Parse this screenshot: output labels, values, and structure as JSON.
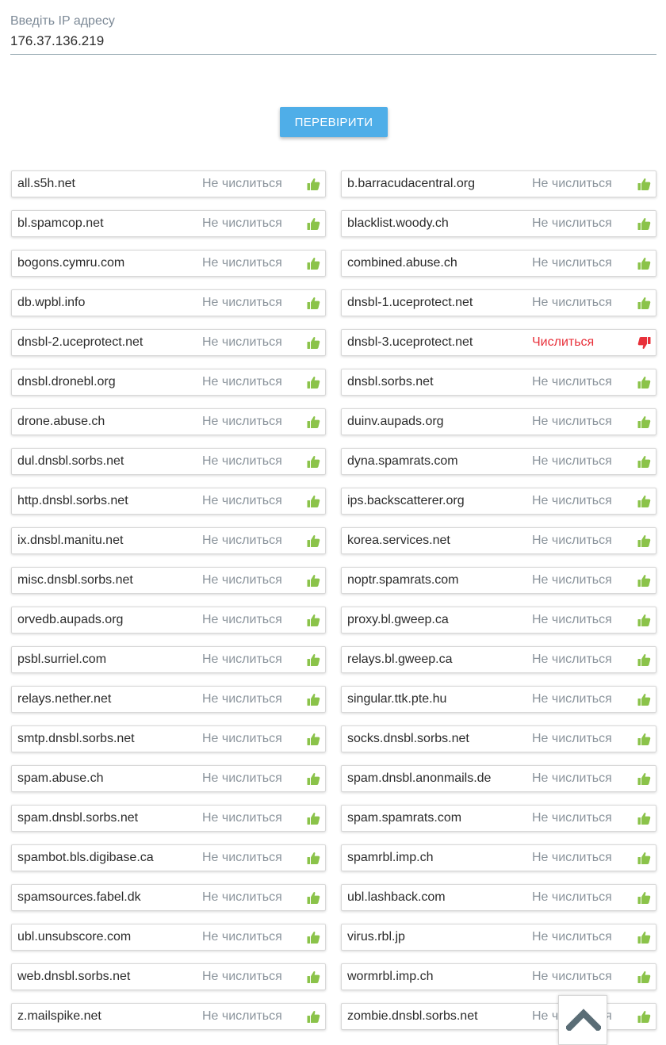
{
  "ip_form": {
    "label": "Введіть IP адресу",
    "value": "176.37.136.219",
    "submit_label": "ПЕРЕВІРИТИ"
  },
  "status_labels": {
    "not_listed": "Не числиться",
    "listed": "Числиться"
  },
  "colors": {
    "accent": "#4faee8",
    "ok": "#8bc34a",
    "listed": "#e8303a",
    "status_text": "#8b949c"
  },
  "icons": {
    "not_listed": "thumbs-up-icon",
    "listed": "thumbs-down-icon",
    "scroll_top": "chevron-up-icon"
  },
  "results": [
    {
      "host": "all.s5h.net",
      "listed": false
    },
    {
      "host": "b.barracudacentral.org",
      "listed": false
    },
    {
      "host": "bl.spamcop.net",
      "listed": false
    },
    {
      "host": "blacklist.woody.ch",
      "listed": false
    },
    {
      "host": "bogons.cymru.com",
      "listed": false
    },
    {
      "host": "combined.abuse.ch",
      "listed": false
    },
    {
      "host": "db.wpbl.info",
      "listed": false
    },
    {
      "host": "dnsbl-1.uceprotect.net",
      "listed": false
    },
    {
      "host": "dnsbl-2.uceprotect.net",
      "listed": false
    },
    {
      "host": "dnsbl-3.uceprotect.net",
      "listed": true
    },
    {
      "host": "dnsbl.dronebl.org",
      "listed": false
    },
    {
      "host": "dnsbl.sorbs.net",
      "listed": false
    },
    {
      "host": "drone.abuse.ch",
      "listed": false
    },
    {
      "host": "duinv.aupads.org",
      "listed": false
    },
    {
      "host": "dul.dnsbl.sorbs.net",
      "listed": false
    },
    {
      "host": "dyna.spamrats.com",
      "listed": false
    },
    {
      "host": "http.dnsbl.sorbs.net",
      "listed": false
    },
    {
      "host": "ips.backscatterer.org",
      "listed": false
    },
    {
      "host": "ix.dnsbl.manitu.net",
      "listed": false
    },
    {
      "host": "korea.services.net",
      "listed": false
    },
    {
      "host": "misc.dnsbl.sorbs.net",
      "listed": false
    },
    {
      "host": "noptr.spamrats.com",
      "listed": false
    },
    {
      "host": "orvedb.aupads.org",
      "listed": false
    },
    {
      "host": "proxy.bl.gweep.ca",
      "listed": false
    },
    {
      "host": "psbl.surriel.com",
      "listed": false
    },
    {
      "host": "relays.bl.gweep.ca",
      "listed": false
    },
    {
      "host": "relays.nether.net",
      "listed": false
    },
    {
      "host": "singular.ttk.pte.hu",
      "listed": false
    },
    {
      "host": "smtp.dnsbl.sorbs.net",
      "listed": false
    },
    {
      "host": "socks.dnsbl.sorbs.net",
      "listed": false
    },
    {
      "host": "spam.abuse.ch",
      "listed": false
    },
    {
      "host": "spam.dnsbl.anonmails.de",
      "listed": false
    },
    {
      "host": "spam.dnsbl.sorbs.net",
      "listed": false
    },
    {
      "host": "spam.spamrats.com",
      "listed": false
    },
    {
      "host": "spambot.bls.digibase.ca",
      "listed": false
    },
    {
      "host": "spamrbl.imp.ch",
      "listed": false
    },
    {
      "host": "spamsources.fabel.dk",
      "listed": false
    },
    {
      "host": "ubl.lashback.com",
      "listed": false
    },
    {
      "host": "ubl.unsubscore.com",
      "listed": false
    },
    {
      "host": "virus.rbl.jp",
      "listed": false
    },
    {
      "host": "web.dnsbl.sorbs.net",
      "listed": false
    },
    {
      "host": "wormrbl.imp.ch",
      "listed": false
    },
    {
      "host": "z.mailspike.net",
      "listed": false
    },
    {
      "host": "zombie.dnsbl.sorbs.net",
      "listed": false
    }
  ]
}
